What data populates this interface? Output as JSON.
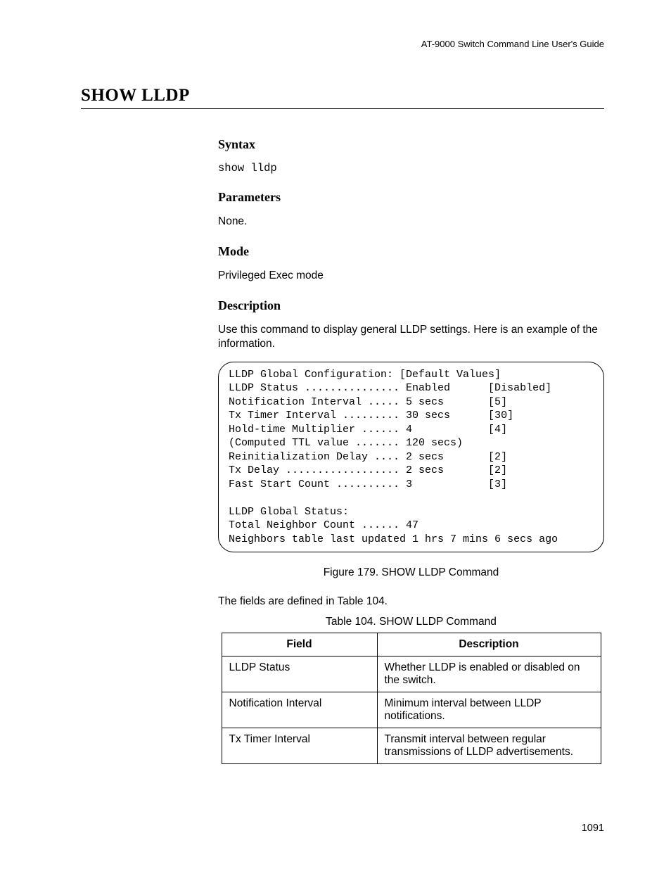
{
  "header": {
    "guide_title": "AT-9000 Switch Command Line User's Guide"
  },
  "command": {
    "title": "SHOW LLDP"
  },
  "sections": {
    "syntax": {
      "heading": "Syntax",
      "code": "show lldp"
    },
    "parameters": {
      "heading": "Parameters",
      "text": "None."
    },
    "mode": {
      "heading": "Mode",
      "text": "Privileged Exec mode"
    },
    "description": {
      "heading": "Description",
      "text": "Use this command to display general LLDP settings. Here is an example of the information."
    }
  },
  "output_box": "LLDP Global Configuration: [Default Values]\nLLDP Status ............... Enabled      [Disabled]\nNotification Interval ..... 5 secs       [5]\nTx Timer Interval ......... 30 secs      [30]\nHold-time Multiplier ...... 4            [4]\n(Computed TTL value ....... 120 secs)\nReinitialization Delay .... 2 secs       [2]\nTx Delay .................. 2 secs       [2]\nFast Start Count .......... 3            [3]\n\nLLDP Global Status:\nTotal Neighbor Count ...... 47\nNeighbors table last updated 1 hrs 7 mins 6 secs ago",
  "figure_caption": "Figure 179. SHOW LLDP Command",
  "fields_intro": "The fields are defined in Table 104.",
  "table_caption": "Table 104. SHOW LLDP Command",
  "table": {
    "headers": {
      "col1": "Field",
      "col2": "Description"
    },
    "rows": [
      {
        "field": "LLDP Status",
        "description": "Whether LLDP is enabled or disabled on the switch."
      },
      {
        "field": "Notification Interval",
        "description": "Minimum interval between LLDP notifications."
      },
      {
        "field": "Tx Timer Interval",
        "description": "Transmit interval between regular transmissions of LLDP advertisements."
      }
    ]
  },
  "page_number": "1091"
}
